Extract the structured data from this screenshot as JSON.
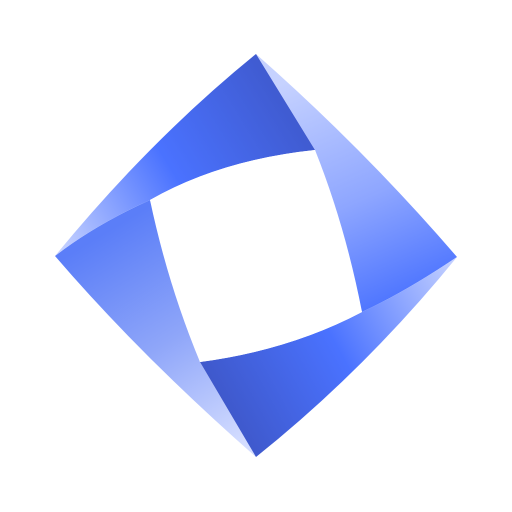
{
  "logo": {
    "icon": "twisted-square-ribbon-logo",
    "colors": {
      "background": "#ffffff",
      "blue_bright": "#4a72ff",
      "blue_mid": "#6b8bf6",
      "blue_dark": "#3d55c4",
      "blue_pale": "#c6d2ff",
      "hole": "#ffffff"
    }
  }
}
